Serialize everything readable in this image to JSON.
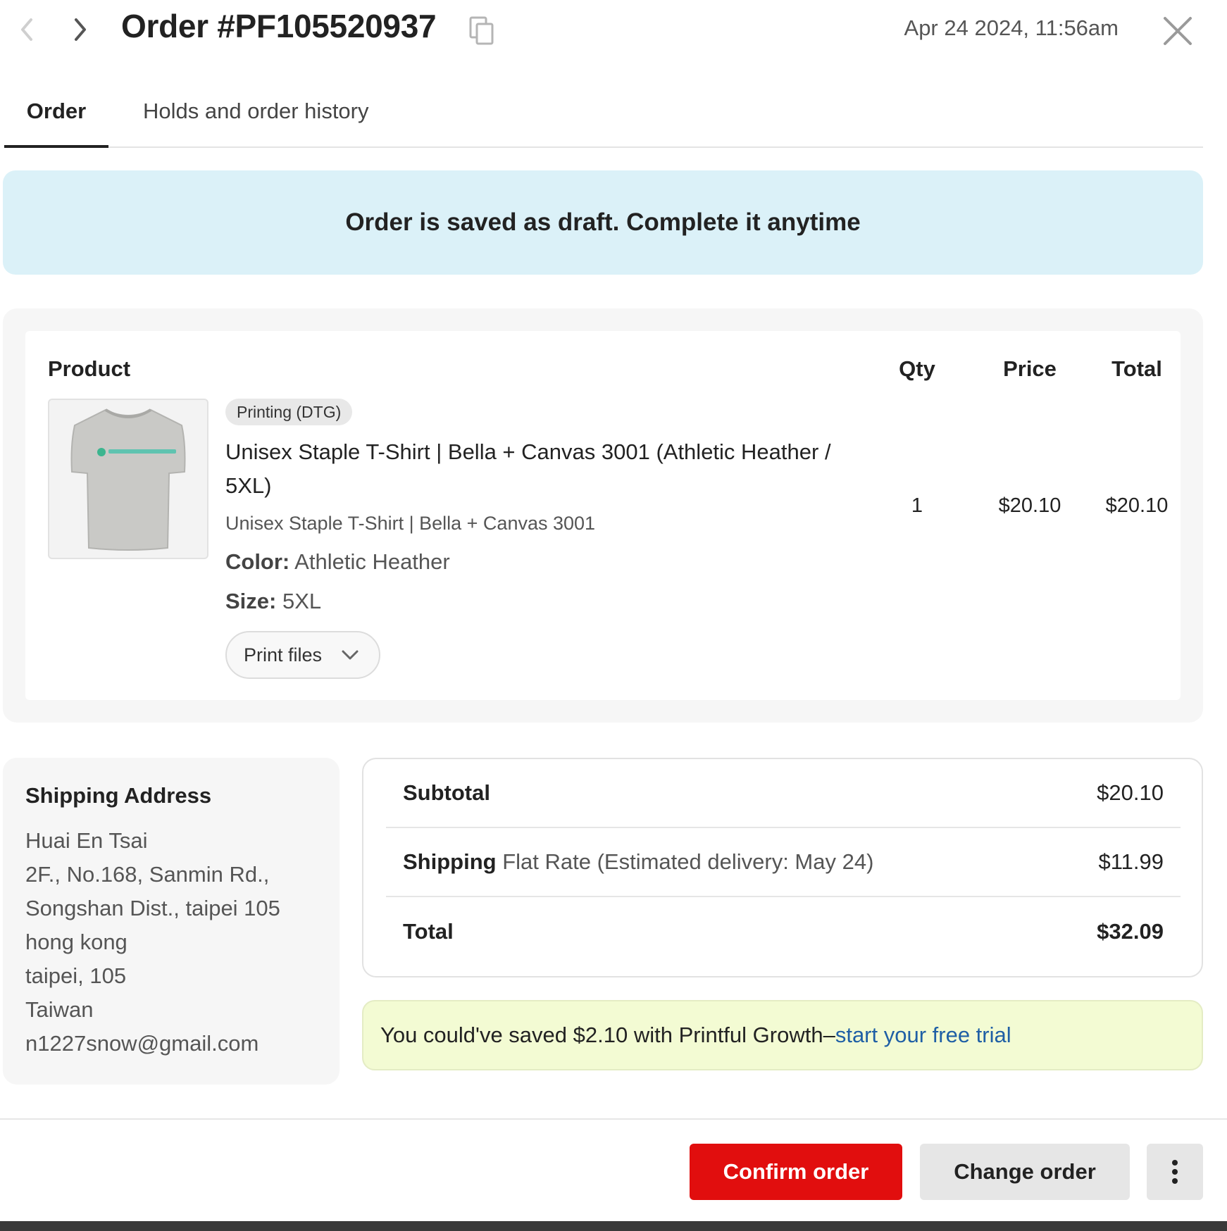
{
  "header": {
    "title": "Order #PF105520937",
    "date": "Apr 24 2024, 11:56am"
  },
  "tabs": [
    {
      "label": "Order",
      "active": true
    },
    {
      "label": "Holds and order history",
      "active": false
    }
  ],
  "banner": {
    "text": "Order is saved as draft. Complete it anytime"
  },
  "product_table": {
    "headers": {
      "product": "Product",
      "qty": "Qty",
      "price": "Price",
      "total": "Total"
    },
    "items": [
      {
        "badge": "Printing (DTG)",
        "name": "Unisex Staple T-Shirt | Bella + Canvas 3001 (Athletic Heather / 5XL)",
        "subtitle": "Unisex Staple T-Shirt | Bella + Canvas 3001",
        "color_label": "Color:",
        "color_value": "Athletic Heather",
        "size_label": "Size:",
        "size_value": "5XL",
        "print_files_label": "Print files",
        "qty": "1",
        "price": "$20.10",
        "total": "$20.10"
      }
    ]
  },
  "shipping_address": {
    "title": "Shipping Address",
    "lines": [
      "Huai En Tsai",
      "2F., No.168, Sanmin Rd.,",
      "Songshan Dist., taipei 105",
      "hong kong",
      "taipei, 105",
      "Taiwan",
      "n1227snow@gmail.com"
    ]
  },
  "summary": {
    "subtotal_label": "Subtotal",
    "subtotal_value": "$20.10",
    "shipping_label": "Shipping",
    "shipping_method": "Flat Rate (Estimated delivery: May 24)",
    "shipping_value": "$11.99",
    "total_label": "Total",
    "total_value": "$32.09"
  },
  "promo": {
    "text": "You could've saved $2.10 with Printful Growth–",
    "link": "start your free trial"
  },
  "footer": {
    "confirm_label": "Confirm order",
    "change_label": "Change order"
  },
  "colors": {
    "accent_red": "#e10e0e",
    "banner_blue": "#dbf1f8",
    "promo_green": "#f3fbd3",
    "link_blue": "#1f5fa5"
  }
}
